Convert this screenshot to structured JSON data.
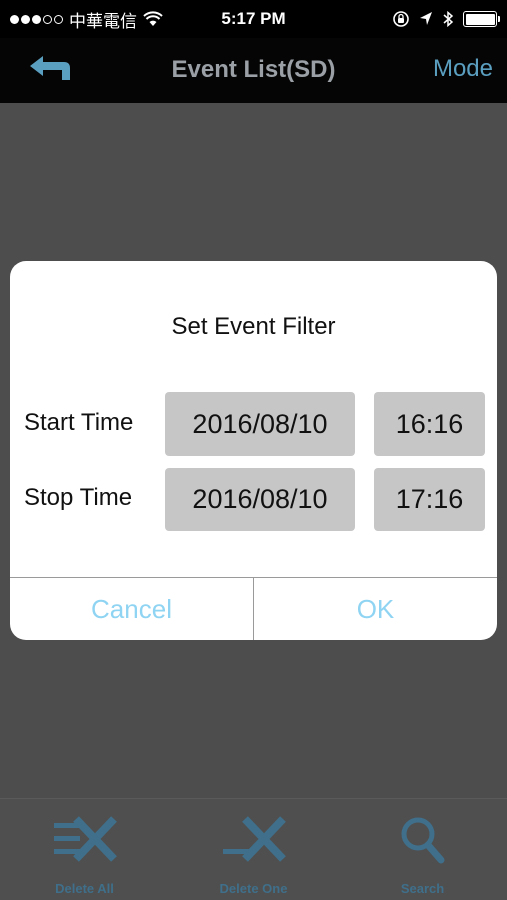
{
  "status_bar": {
    "carrier": "中華電信",
    "time": "5:17 PM",
    "battery_level": 1.0
  },
  "nav": {
    "title": "Event List(SD)",
    "mode_label": "Mode",
    "back_icon": "back-arrow-icon"
  },
  "dialog": {
    "title": "Set Event Filter",
    "start": {
      "label": "Start Time",
      "date": "2016/08/10",
      "time": "16:16"
    },
    "stop": {
      "label": "Stop Time",
      "date": "2016/08/10",
      "time": "17:16"
    },
    "cancel_label": "Cancel",
    "ok_label": "OK"
  },
  "tabs": [
    {
      "label": "Delete All",
      "icon": "delete-all-icon"
    },
    {
      "label": "Delete One",
      "icon": "delete-one-icon"
    },
    {
      "label": "Search",
      "icon": "search-icon"
    }
  ],
  "colors": {
    "accent": "#5b9fc0",
    "dialog_button": "#8fd4f2",
    "tab_icon": "#3f6f8a"
  }
}
